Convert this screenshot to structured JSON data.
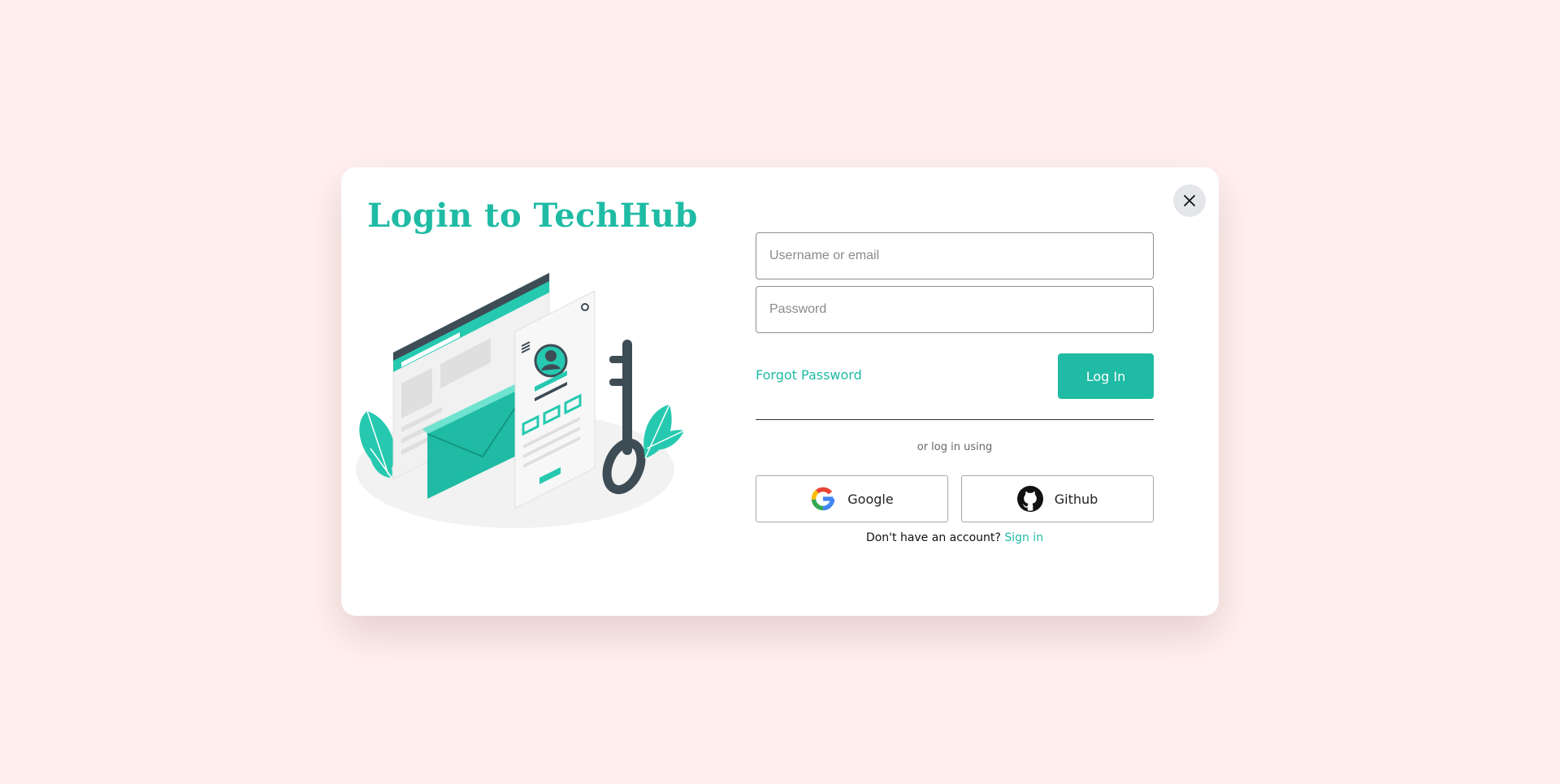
{
  "colors": {
    "background": "#fff0ef",
    "modal": "#ffffff",
    "accent": "#1fbba4",
    "dark": "#3e4c55"
  },
  "modal": {
    "title": "Login to TechHub",
    "close_icon": "close-icon",
    "illustration": "login-illustration"
  },
  "form": {
    "username_placeholder": "Username or email",
    "username_value": "",
    "password_placeholder": "Password",
    "password_value": "",
    "forgot_label": "Forgot Password",
    "login_label": "Log In",
    "or_text": "or log in using"
  },
  "social": {
    "google_label": "Google",
    "google_icon": "google-icon",
    "github_label": "Github",
    "github_icon": "github-icon"
  },
  "signup": {
    "prompt": "Don't have an account?",
    "link": "Sign in"
  }
}
